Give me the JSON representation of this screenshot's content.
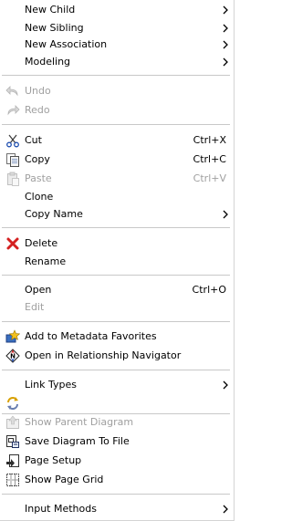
{
  "menu": {
    "new_child": "New Child",
    "new_sibling": "New Sibling",
    "new_association": "New Association",
    "modeling": "Modeling",
    "undo": "Undo",
    "redo": "Redo",
    "cut": "Cut",
    "cut_accel": "Ctrl+X",
    "copy": "Copy",
    "copy_accel": "Ctrl+C",
    "paste": "Paste",
    "paste_accel": "Ctrl+V",
    "clone": "Clone",
    "copy_name": "Copy Name",
    "delete": "Delete",
    "rename": "Rename",
    "open": "Open",
    "open_accel": "Ctrl+O",
    "edit": "Edit",
    "add_favorites": "Add to Metadata Favorites",
    "open_navigator": "Open in Relationship Navigator",
    "link_types": "Link Types",
    "show_parent_diagram": "Show Parent Diagram",
    "save_diagram": "Save Diagram To File",
    "page_setup": "Page Setup",
    "show_page_grid": "Show Page Grid",
    "input_methods": "Input Methods"
  },
  "colors": {
    "disabled_text": "#a0a0a0",
    "separator": "#c8c8c8",
    "delete_icon": "#d42020"
  }
}
